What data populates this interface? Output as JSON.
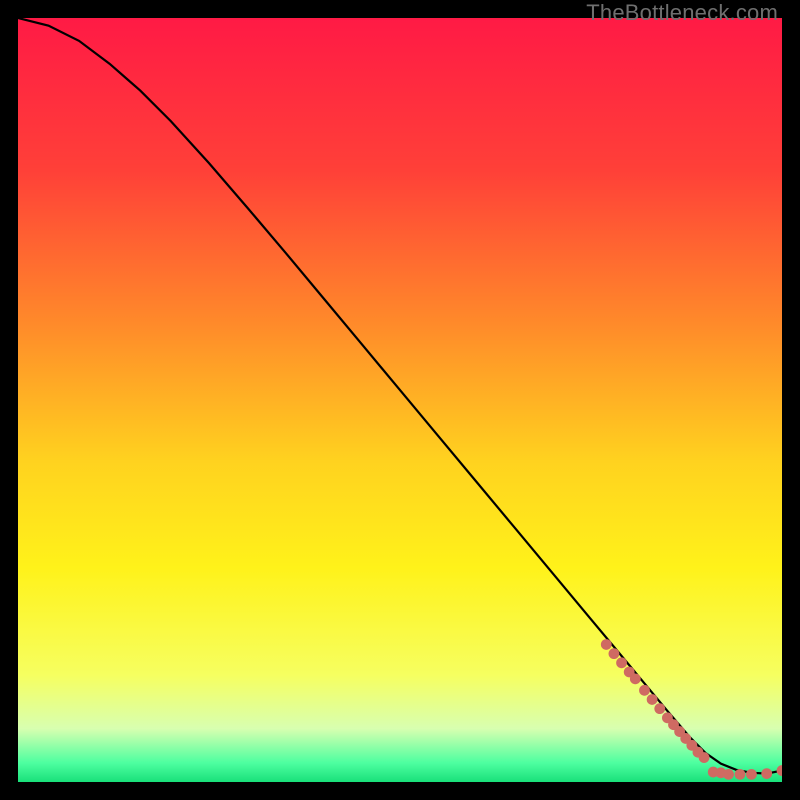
{
  "watermark": "TheBottleneck.com",
  "chart_data": {
    "type": "line",
    "title": "",
    "xlabel": "",
    "ylabel": "",
    "xlim": [
      0,
      100
    ],
    "ylim": [
      0,
      100
    ],
    "background_gradient": {
      "stops": [
        {
          "offset": 0.0,
          "color": "#ff1a45"
        },
        {
          "offset": 0.2,
          "color": "#ff4038"
        },
        {
          "offset": 0.4,
          "color": "#ff8a2a"
        },
        {
          "offset": 0.58,
          "color": "#ffd21f"
        },
        {
          "offset": 0.72,
          "color": "#fff21a"
        },
        {
          "offset": 0.86,
          "color": "#f6ff60"
        },
        {
          "offset": 0.93,
          "color": "#d8ffb0"
        },
        {
          "offset": 0.975,
          "color": "#4dffa0"
        },
        {
          "offset": 1.0,
          "color": "#19e07a"
        }
      ]
    },
    "series": [
      {
        "name": "curve",
        "x": [
          0,
          4,
          8,
          12,
          16,
          20,
          25,
          30,
          35,
          40,
          45,
          50,
          55,
          60,
          65,
          70,
          75,
          80,
          85,
          88,
          90,
          92,
          94,
          96,
          98,
          100
        ],
        "y": [
          100,
          99.0,
          97.0,
          94.0,
          90.5,
          86.5,
          81.0,
          75.2,
          69.3,
          63.3,
          57.3,
          51.3,
          45.3,
          39.3,
          33.3,
          27.3,
          21.3,
          15.3,
          9.3,
          5.8,
          3.8,
          2.4,
          1.6,
          1.2,
          1.1,
          1.5
        ]
      }
    ],
    "markers": [
      {
        "x": 77,
        "y": 18.0
      },
      {
        "x": 78,
        "y": 16.8
      },
      {
        "x": 79,
        "y": 15.6
      },
      {
        "x": 80,
        "y": 14.4
      },
      {
        "x": 80.8,
        "y": 13.5
      },
      {
        "x": 82,
        "y": 12.0
      },
      {
        "x": 83,
        "y": 10.8
      },
      {
        "x": 84,
        "y": 9.6
      },
      {
        "x": 85,
        "y": 8.4
      },
      {
        "x": 85.8,
        "y": 7.5
      },
      {
        "x": 86.6,
        "y": 6.6
      },
      {
        "x": 87.4,
        "y": 5.7
      },
      {
        "x": 88.2,
        "y": 4.8
      },
      {
        "x": 89,
        "y": 3.9
      },
      {
        "x": 89.8,
        "y": 3.2
      },
      {
        "x": 91,
        "y": 1.3
      },
      {
        "x": 92,
        "y": 1.2
      },
      {
        "x": 93,
        "y": 1.0
      },
      {
        "x": 94.5,
        "y": 1.0
      },
      {
        "x": 96,
        "y": 1.0
      },
      {
        "x": 98,
        "y": 1.1
      },
      {
        "x": 100,
        "y": 1.5
      }
    ],
    "marker_style": {
      "radius": 5.4,
      "fill": "#cf6a62"
    }
  }
}
